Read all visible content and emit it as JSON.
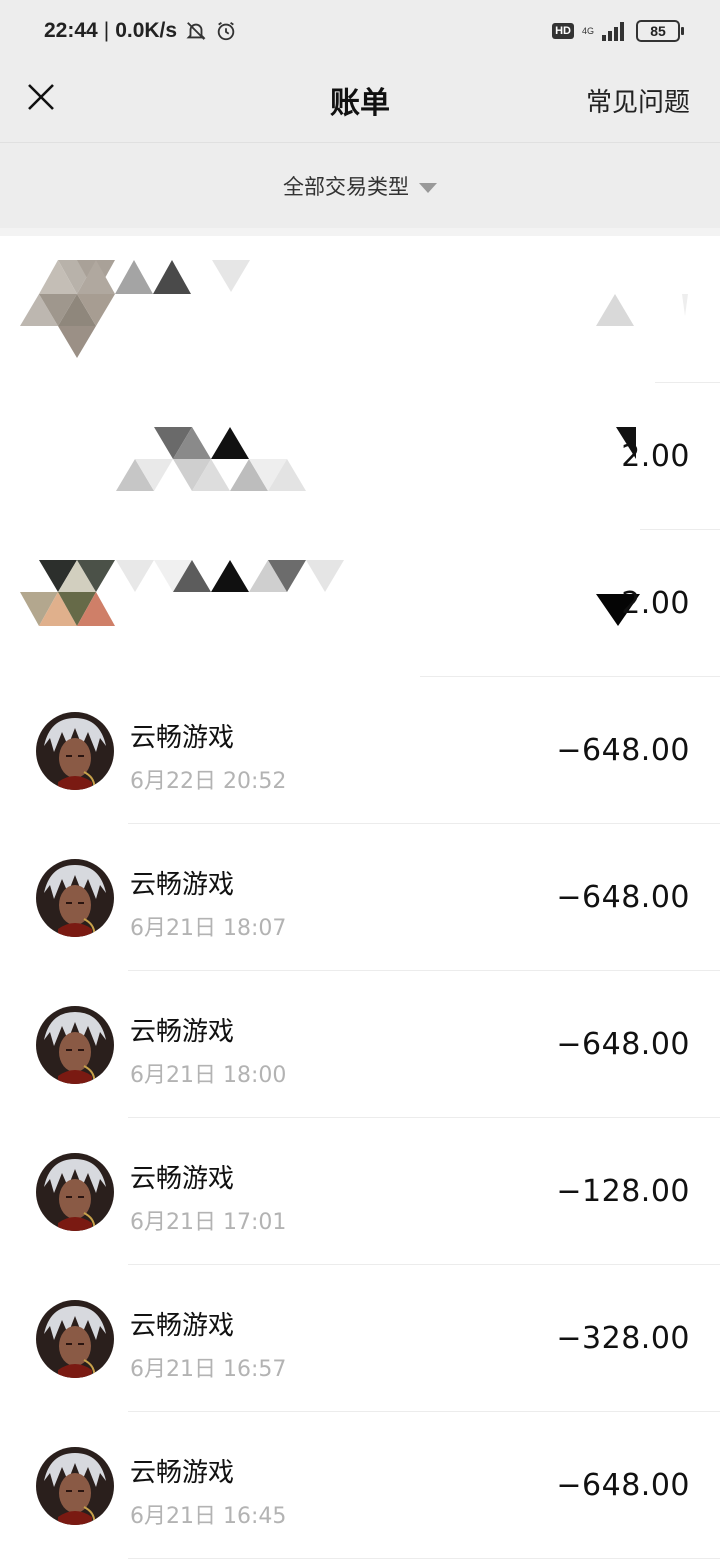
{
  "status_bar": {
    "time": "22:44",
    "separator": "|",
    "net_speed": "0.0K/s",
    "hd_label": "HD",
    "network_label": "4G",
    "battery_level": "85"
  },
  "nav": {
    "title": "账单",
    "help_label": "常见问题"
  },
  "filter": {
    "label": "全部交易类型"
  },
  "redacted_rows": [
    {
      "amount": ""
    },
    {
      "amount": "2.00"
    },
    {
      "amount": "2.00"
    }
  ],
  "transactions": [
    {
      "merchant": "云畅游戏",
      "time": "6月22日 20:52",
      "amount": "−648.00"
    },
    {
      "merchant": "云畅游戏",
      "time": "6月21日 18:07",
      "amount": "−648.00"
    },
    {
      "merchant": "云畅游戏",
      "time": "6月21日 18:00",
      "amount": "−648.00"
    },
    {
      "merchant": "云畅游戏",
      "time": "6月21日 17:01",
      "amount": "−128.00"
    },
    {
      "merchant": "云畅游戏",
      "time": "6月21日 16:57",
      "amount": "−328.00"
    },
    {
      "merchant": "云畅游戏",
      "time": "6月21日 16:45",
      "amount": "−648.00"
    }
  ]
}
